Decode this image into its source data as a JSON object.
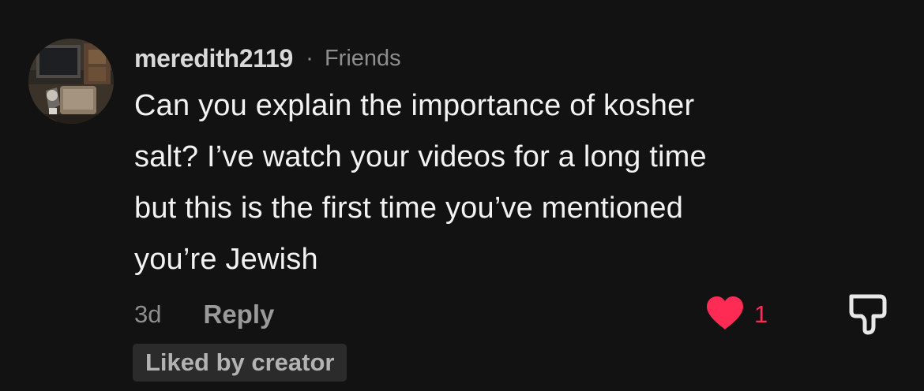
{
  "comment": {
    "avatar_icon": "user-photo-avatar",
    "username": "meredith2119",
    "separator": "·",
    "relation": "Friends",
    "text_lines": [
      "Can you explain the importance of kosher",
      "salt? I’ve watch your videos for a long time",
      "but this is the first time you’ve mentioned",
      "you’re Jewish"
    ],
    "time": "3d",
    "reply_label": "Reply",
    "like_icon": "heart-icon",
    "like_count": "1",
    "like_color": "#fe2c55",
    "dislike_icon": "thumbs-down-icon",
    "badge": "Liked by creator"
  }
}
